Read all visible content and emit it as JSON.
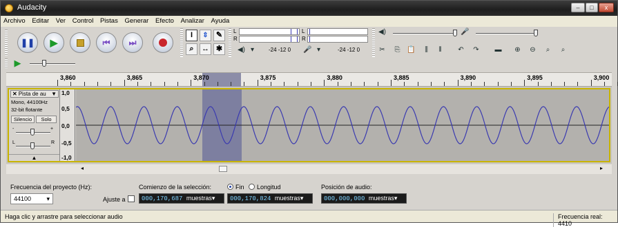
{
  "window": {
    "title": "Audacity",
    "min": "–",
    "max": "□",
    "close": "x"
  },
  "menu": [
    "Archivo",
    "Editar",
    "Ver",
    "Control",
    "Pistas",
    "Generar",
    "Efecto",
    "Analizar",
    "Ayuda"
  ],
  "meters": {
    "rec_scale": "-24 -12 0",
    "play_scale": "-24 -12 0",
    "L": "L",
    "R": "R"
  },
  "ruler": {
    "labels": [
      "3,860",
      "3,865",
      "3,870",
      "3,875",
      "3,880",
      "3,885",
      "3,890",
      "3,895",
      "3,900"
    ]
  },
  "track": {
    "name": "Pista de au",
    "info1": "Mono, 44100Hz",
    "info2": "32-bit flotante",
    "mute": "Silencio",
    "solo": "Solo",
    "gain_minus": "-",
    "gain_plus": "+",
    "pan_l": "L",
    "pan_r": "R",
    "scale": [
      "1,0",
      "0,5",
      "0,0",
      "-0,5",
      "-1,0"
    ]
  },
  "selection_bar": {
    "left_arrow": "◂",
    "right_arrow": "▸"
  },
  "bottom": {
    "rate_label": "Frecuencia del proyecto (Hz):",
    "rate_value": "44100",
    "snap_label": "Ajuste a",
    "sel_start_label": "Comienzo de la selección:",
    "end_label": "Fin",
    "length_label": "Longitud",
    "sel_start": "000,170,687",
    "sel_end": "000,170,824",
    "pos_label": "Posición de audio:",
    "pos": "000,000,000",
    "unit": "muestras"
  },
  "status": {
    "left": "Haga clic y arrastre para seleccionar audio",
    "right": "Frecuencia real: 4410"
  },
  "colors": {
    "wave": "#3a3ab0",
    "selection": "#7d7fa0",
    "track_border": "#c8b400"
  }
}
